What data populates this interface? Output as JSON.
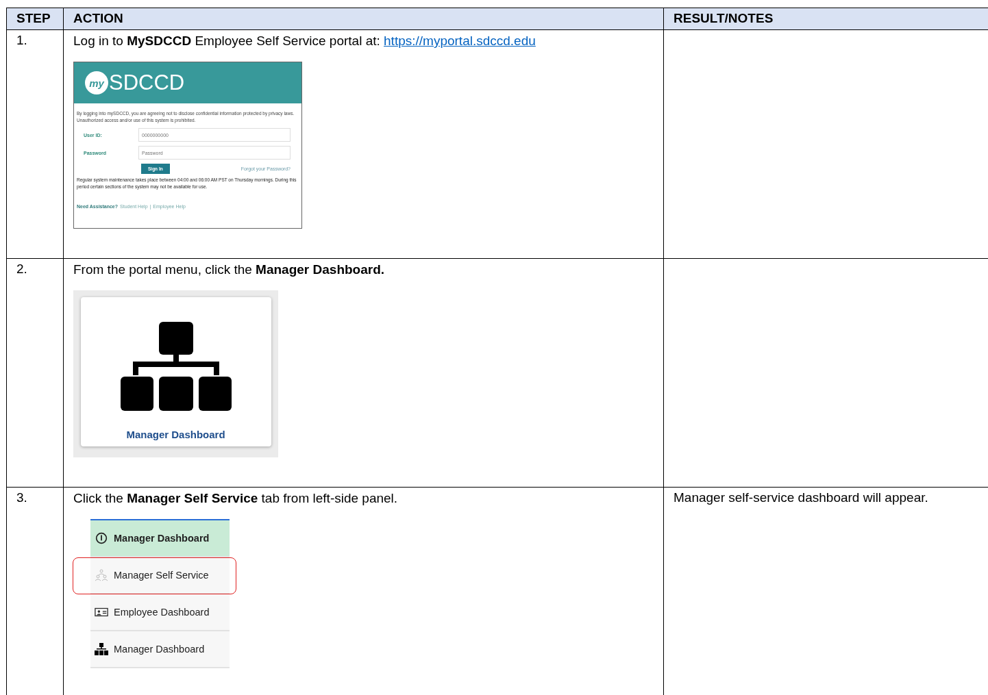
{
  "table": {
    "columns": [
      "STEP",
      "ACTION",
      "RESULT/NOTES"
    ],
    "rows": [
      {
        "step": "1.",
        "kind": "login",
        "action": "Log in to **MySDCCD** Employee Self Service portal at: ",
        "link": "https://myportal.sdccd.edu",
        "screenshot": {
          "logo_badge": "my",
          "logo_text": "SDCCD",
          "notice": "By logging into mySDCCD, you are agreeing not to disclose confidential information protected by privacy laws. Unauthorized access and/or use of this system is prohibited.",
          "fields": [
            {
              "label": "User ID:",
              "placeholder": "0000000000"
            },
            {
              "label": "Password",
              "placeholder": "Password"
            }
          ],
          "button": "Sign In",
          "forgot": "Forgot your Password?",
          "maintenance": "Regular system maintenance takes place between 04:00 and 06:00 AM PST on Thursday mornings. During this period certain sections of the system may not be available for use.",
          "assist": "Need Assistance?",
          "help_links": [
            "Student Help",
            "Employee Help"
          ],
          "separator": "|"
        }
      },
      {
        "step": "2.",
        "kind": "tile",
        "action": "From the portal menu, click the **Manager Dashboard.**",
        "screenshot": {
          "tile_label": "Manager Dashboard"
        }
      },
      {
        "step": "3.",
        "kind": "panel",
        "action": "Click the **Manager Self Service** tab from left-side panel.",
        "notes": "Manager self-service dashboard will appear.",
        "screenshot": {
          "items": [
            {
              "label": "Manager Dashboard",
              "selected": true,
              "highlighted": false
            },
            {
              "label": "Manager Self Service",
              "selected": false,
              "highlighted": true
            },
            {
              "label": "Employee Dashboard",
              "selected": false,
              "highlighted": false
            },
            {
              "label": "Manager Dashboard",
              "selected": false,
              "highlighted": false
            }
          ]
        }
      }
    ]
  }
}
